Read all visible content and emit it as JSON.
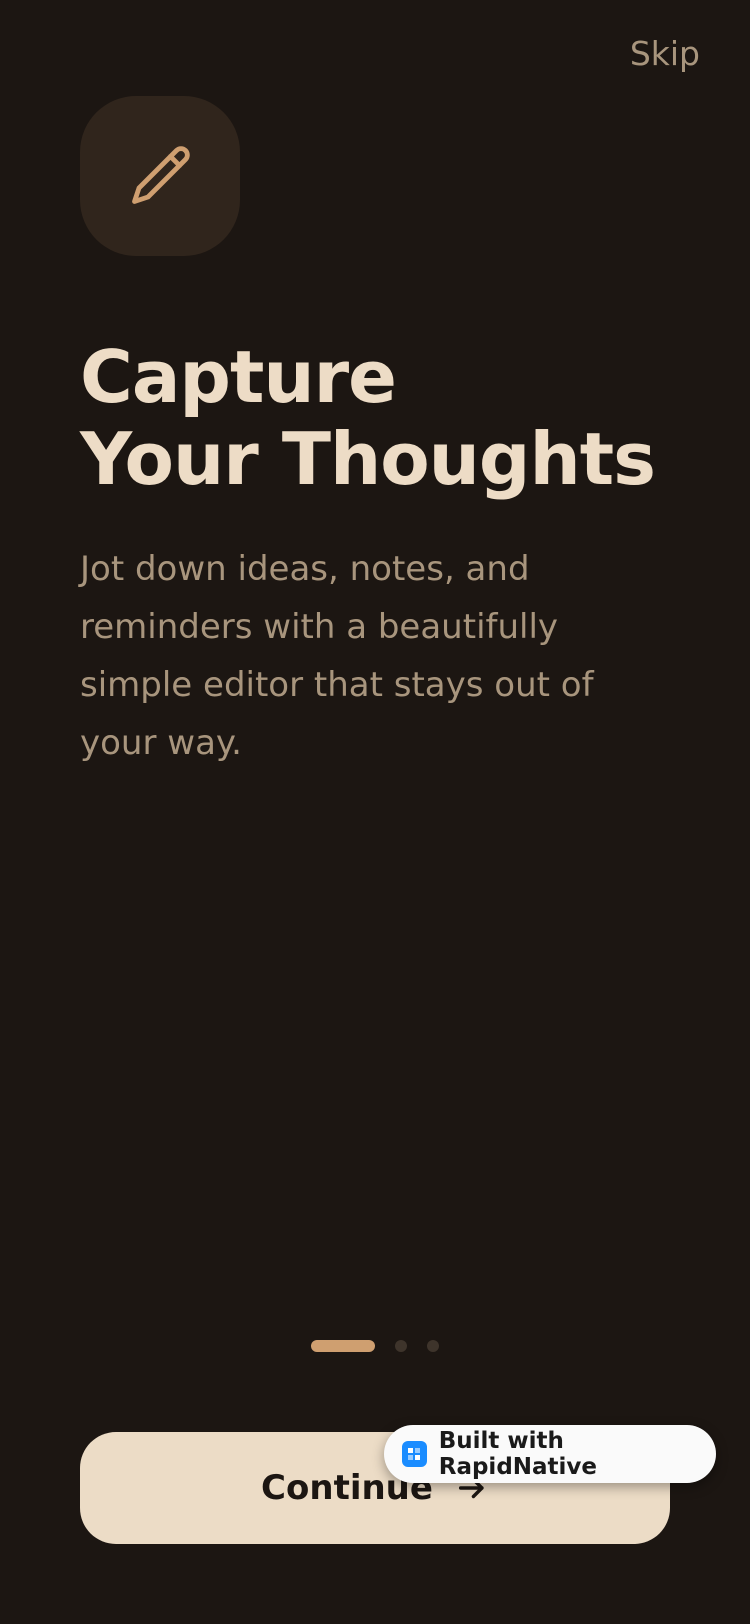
{
  "header": {
    "skip_label": "Skip"
  },
  "hero": {
    "icon": "pencil-icon",
    "title_line1": "Capture",
    "title_line2": "Your Thoughts",
    "description": "Jot down ideas, notes, and reminders with a beautifully simple editor that stays out of your way."
  },
  "pagination": {
    "current_page": 1,
    "total_pages": 3
  },
  "footer": {
    "continue_label": "Continue",
    "continue_icon": "arrow-right-icon"
  },
  "badge": {
    "label": "Built with RapidNative",
    "icon": "rapidnative-logo-icon"
  },
  "colors": {
    "background": "#1c1612",
    "accent": "#cf9f70",
    "title": "#eddcc6",
    "muted_text": "#a8957d",
    "button_bg": "#ecdcc6"
  }
}
